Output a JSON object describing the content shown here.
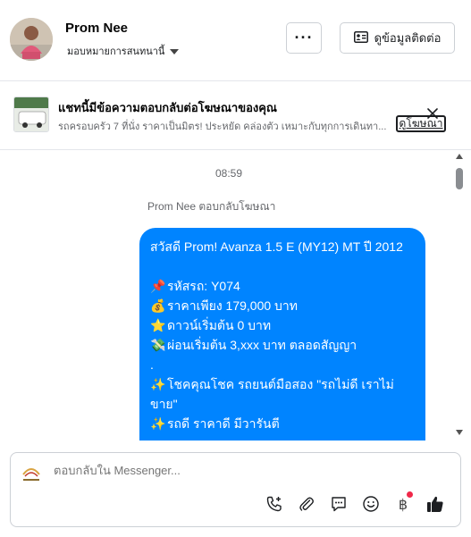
{
  "header": {
    "name": "Prom Nee",
    "assign_label": "มอบหมายการสนทนานี้",
    "more_label": "···",
    "contact_label": "ดูข้อมูลติดต่อ"
  },
  "ad_banner": {
    "title": "แชทนี้มีข้อความตอบกลับต่อโฆษณาของคุณ",
    "description": "รถครอบครัว 7 ที่นั่ง ราคาเป็นมิตร! ประหยัด คล่องตัว เหมาะกับทุกการเดินทา...",
    "view_ad_label": "ดูโฆษณา"
  },
  "chat": {
    "timestamp": "08:59",
    "replied_note": "Prom Nee ตอบกลับโฆษณา",
    "message_lines": [
      {
        "icon": "",
        "text": "สวัสดี Prom! Avanza 1.5 E (MY12) MT ปี 2012"
      },
      {
        "icon": "",
        "text": ""
      },
      {
        "icon": "📌",
        "text": "รหัสรถ: Y074"
      },
      {
        "icon": "💰",
        "text": "ราคาเพียง 179,000 บาท"
      },
      {
        "icon": "⭐",
        "text": "ดาวน์เริ่มต้น 0 บาท"
      },
      {
        "icon": "💸",
        "text": "ผ่อนเริ่มต้น 3,xxx บาท ตลอดสัญญา"
      },
      {
        "icon": "",
        "text": "."
      },
      {
        "icon": "✨",
        "text": "โชคคุณโชค รถยนต์มือสอง \"รถไม่ดี เราไม่ขาย\""
      },
      {
        "icon": "✨",
        "text": "รถดี ราคาดี มีวารันตี"
      }
    ]
  },
  "composer": {
    "placeholder": "ตอบกลับใน Messenger..."
  },
  "icons": {
    "toolbar": [
      "phone-add-icon",
      "attachment-icon",
      "saved-reply-icon",
      "emoji-icon",
      "baht-payment-icon",
      "thumbs-up-icon"
    ]
  },
  "colors": {
    "bubble": "#0084ff",
    "notification_dot": "#f02849"
  }
}
